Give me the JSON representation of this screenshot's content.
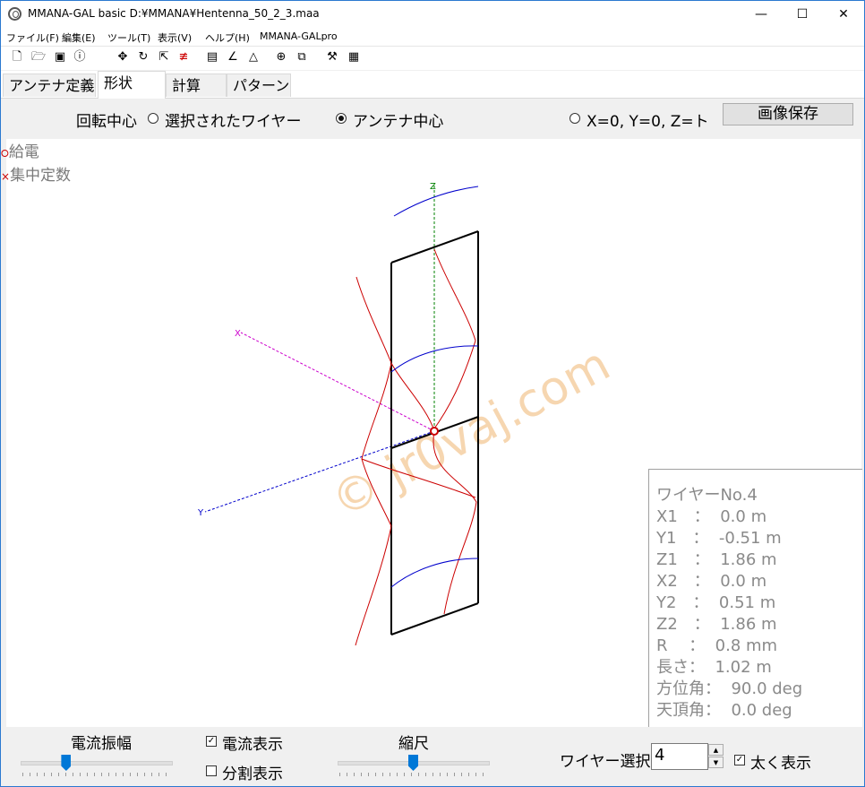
{
  "window": {
    "title": "MMANA-GAL basic D:¥MMANA¥Hentenna_50_2_3.maa",
    "minimize": "—",
    "maximize": "☐",
    "close": "✕"
  },
  "menu": [
    "ファイル(F)",
    "編集(E)",
    "ツール(T)",
    "表示(V)",
    "ヘルプ(H)",
    "MMANA-GALpro"
  ],
  "toolbar_icons": [
    "new-file-icon",
    "open-folder-icon",
    "save-icon",
    "info-icon",
    "move-icon",
    "rotate-icon",
    "zoom-icon",
    "split-icon",
    "document-icon",
    "chart-icon",
    "triangle-icon",
    "target-icon",
    "copy-icon",
    "tools-icon",
    "calculator-icon"
  ],
  "tabs": [
    "アンテナ定義",
    "形状",
    "計算",
    "パターン"
  ],
  "active_tab": 1,
  "options": {
    "rotation_center_label": "回転中心",
    "radio_selected_wire": "選択されたワイヤー",
    "radio_antenna_center": "アンテナ中心",
    "radio_xyz": "X=0, Y=0, Z=ト",
    "selected_radio": "antenna_center",
    "save_image_button": "画像保存"
  },
  "legend": {
    "feed": "給電",
    "lumped": "集中定数"
  },
  "view": {
    "axis_z": "Z",
    "axis_x": "X",
    "axis_y": "Y",
    "watermark": "© jr0vaj.com"
  },
  "wire_info": {
    "title": "ワイヤーNo.4",
    "rows": [
      "X1　：  0.0 m",
      "Y1　：  -0.51 m",
      "Z1　：  1.86 m",
      "X2　：  0.0 m",
      "Y2　：  0.51 m",
      "Z2　：  1.86 m",
      "R　 ：  0.8 mm",
      "長さ：  1.02 m",
      "方位角：  90.0 deg",
      "天頂角：  0.0 deg"
    ]
  },
  "bottom": {
    "current_amplitude_label": "電流振幅",
    "current_amplitude_level": 0.3,
    "show_current_label": "電流表示",
    "show_current_checked": true,
    "show_segments_label": "分割表示",
    "show_segments_checked": false,
    "scale_label": "縮尺",
    "scale_level": 0.5,
    "wire_select_label": "ワイヤー選択",
    "wire_select_value": "4",
    "bold_label": "太く表示",
    "bold_checked": true
  },
  "colors": {
    "current_red": "#cc0000",
    "current_blue": "#0000cc",
    "z_axis": "#008000",
    "x_axis": "#cc00cc",
    "y_axis": "#0000cc",
    "watermark": "#f6d6b0"
  }
}
